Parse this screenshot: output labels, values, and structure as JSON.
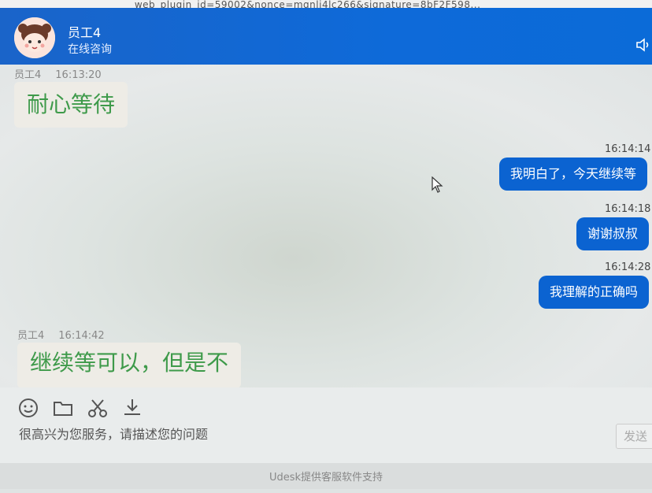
{
  "browser": {
    "url_fragment": "_ web_plugin_id=59002&nonce=mgnli4lc266&signature=8bF2F598..."
  },
  "header": {
    "agent_name": "员工4",
    "agent_status": "在线咨询"
  },
  "messages": [
    {
      "side": "left",
      "sender": "员工4",
      "time": "16:13:20",
      "text": "耐心等待"
    },
    {
      "side": "right",
      "time": "16:14:14",
      "text": "我明白了，今天继续等"
    },
    {
      "side": "right",
      "time": "16:14:18",
      "text": "谢谢叔叔"
    },
    {
      "side": "right",
      "time": "16:14:28",
      "text": "我理解的正确吗"
    },
    {
      "side": "left",
      "sender": "员工4",
      "time": "16:14:42",
      "text": "继续等可以，但是不"
    }
  ],
  "toolbar": {
    "icons": [
      "emoji-icon",
      "folder-icon",
      "scissors-icon",
      "download-icon"
    ],
    "input_placeholder": "很高兴为您服务，请描述您的问题",
    "send_label": "发送"
  },
  "footer": {
    "text": "Udesk提供客服软件支持"
  },
  "colors": {
    "header_blue": "#0e6ad9",
    "bubble_blue": "#0b63d1",
    "agent_text_green": "#3e9a4a"
  }
}
